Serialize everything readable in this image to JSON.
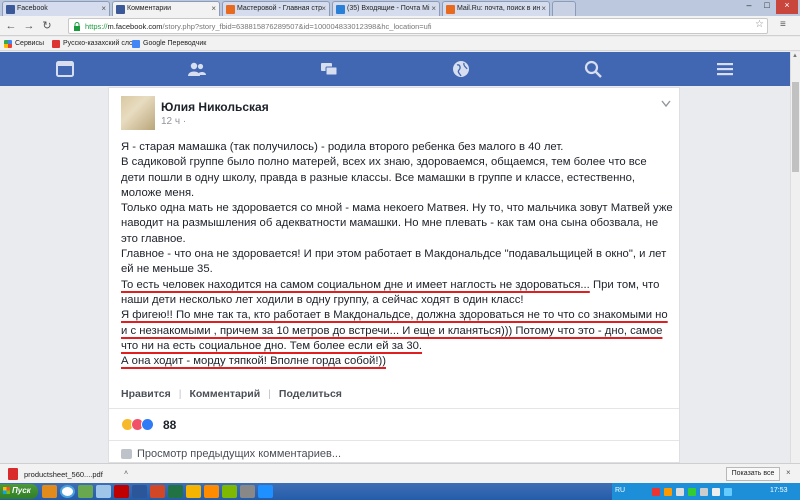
{
  "browser": {
    "tabs": [
      {
        "label": "Facebook",
        "icon": "facebook-icon",
        "active": false
      },
      {
        "label": "Комментарии",
        "icon": "facebook-icon",
        "active": true
      },
      {
        "label": "Мастеровой - Главная стр",
        "icon": "mail-icon",
        "active": false
      },
      {
        "label": "(35) Входящие - Почта Mi",
        "icon": "mail-icon",
        "active": false
      },
      {
        "label": "Mail.Ru: почта, поиск в ин",
        "icon": "mail-icon",
        "active": false
      }
    ],
    "url_scheme": "https://",
    "url_host": "m.facebook.com",
    "url_rest": "/story.php?story_fbid=638815876289507&id=100004833012398&hc_location=ufi",
    "bookmarks": [
      "Сервисы",
      "Русско-казахский слов",
      "Google Переводчик"
    ]
  },
  "post": {
    "author": "Юлия Никольская",
    "time": "12 ч ·",
    "paragraphs": [
      "Я - старая мамашка (так получилось) - родила второго ребенка без малого в 40 лет.",
      "В садиковой группе было полно матерей, всех их знаю, здороваемся, общаемся, тем более что все дети пошли в одну школу, правда в разные классы. Все мамашки в группе и классе, естественно, моложе меня.",
      "Только одна мать не здоровается со мной - мама некоего Матвея. Ну то, что мальчика зовут Матвей уже наводит на размышления об адекватности мамашки. Но мне плевать - как там она сына обозвала, не это главное.",
      "Главное - что она не здоровается! И при этом работает в Макдональдсе \"подавальщицей в окно\", и лет ей не меньше 35."
    ],
    "p5_underlined": "То есть человек находится на самом социальном дне и имеет наглость не здороваться...",
    "p5_rest": " При том, что наши дети несколько лет ходили в одну группу, а сейчас ходят в один класс!",
    "p6": "Я фигею!! По мне так та, кто работает в Макдональдсе, должна здороваться не то что со знакомыми но и с незнакомыми , причем за 10 метров до встречи... И еще и кланяться))) Потому что это - дно, самое что ни на есть социальное дно. Тем более если ей за 30.",
    "p7": "А она ходит - морду тяпкой! Вполне горда собой!))",
    "actions": [
      "Нравится",
      "Комментарий",
      "Поделиться"
    ],
    "reaction_count": "88",
    "prev_comments": "Просмотр предыдущих комментариев..."
  },
  "downloads": {
    "file": "productsheet_560....pdf",
    "show_all": "Показать все"
  },
  "taskbar": {
    "start": "Пуск",
    "lang": "RU",
    "clock": "17:53"
  },
  "colors": {
    "fb_blue": "#4267b2",
    "underline_red": "#e02020"
  }
}
